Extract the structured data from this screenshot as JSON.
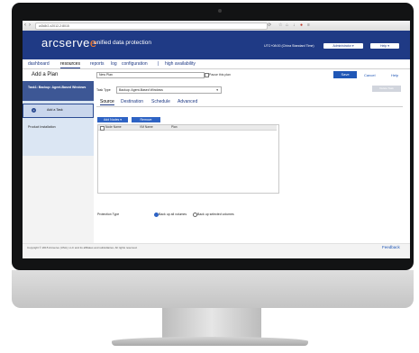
{
  "browser": {
    "url": "w2k8r2-x2012-2:8015",
    "nav_back": "‹",
    "nav_forward": "›",
    "nav_reload": "⟳"
  },
  "header": {
    "logo_text": "arcserve",
    "logo_mark": "e",
    "product_title": "unified data protection",
    "timezone": "UTC+08:00 (China Standard Time)",
    "admin_label": "Administrator ▾",
    "help_label": "Help ▾"
  },
  "nav": {
    "items": [
      "dashboard",
      "resources",
      "reports",
      "log",
      "configuration",
      "|",
      "high availability"
    ],
    "active": "resources"
  },
  "page": {
    "title": "Add a Plan",
    "plan_name_value": "New Plan",
    "pause_label": "Pause this plan",
    "save_label": "Save",
    "cancel_label": "Cancel",
    "help_label": "Help"
  },
  "sidebar": {
    "task1_label": "Task1: Backup: Agent-Based Windows",
    "add_task_label": "Add a Task",
    "product_install_label": "Product Installation"
  },
  "main": {
    "task_type_label": "Task Type",
    "task_type_value": "Backup: Agent-Based Windows",
    "delete_task_label": "Delete Task",
    "tabs": [
      "Source",
      "Destination",
      "Schedule",
      "Advanced"
    ],
    "active_tab": "Source",
    "add_nodes_label": "Add Nodes ▾",
    "remove_label": "Remove",
    "table_columns": [
      "Node Name",
      "VM Name",
      "Plan"
    ],
    "protection_type_label": "Protection Type",
    "radio_all": "Back up all volumes",
    "radio_selected": "Back up selected volumes"
  },
  "footer": {
    "copyright": "Copyright © 2015 Arcserve (USA), LLC and its affiliates and subsidiaries. All rights reserved.",
    "feedback_label": "Feedback"
  },
  "colors": {
    "header_bg": "#1f3a85",
    "accent": "#2057b6",
    "logo_accent": "#ff7f2a"
  }
}
